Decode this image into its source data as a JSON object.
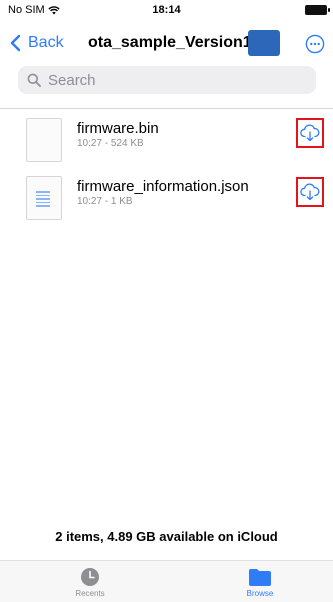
{
  "status_bar": {
    "carrier": "No SIM",
    "time": "18:14"
  },
  "nav": {
    "back_label": "Back",
    "title": "ota_sample_Version1."
  },
  "search": {
    "placeholder": "Search"
  },
  "files": [
    {
      "name": "firmware.bin",
      "meta": "10:27 - 524 KB",
      "icon": "blank-file-icon"
    },
    {
      "name": "firmware_information.json",
      "meta": "10:27 - 1 KB",
      "icon": "text-document-icon"
    }
  ],
  "footer": {
    "storage_text": "2 items, 4.89 GB available on iCloud"
  },
  "tabs": {
    "recents_label": "Recents",
    "browse_label": "Browse"
  },
  "colors": {
    "accent": "#2f7cf6",
    "highlight_box": "#e4141c",
    "redaction": "#2c67b9"
  }
}
